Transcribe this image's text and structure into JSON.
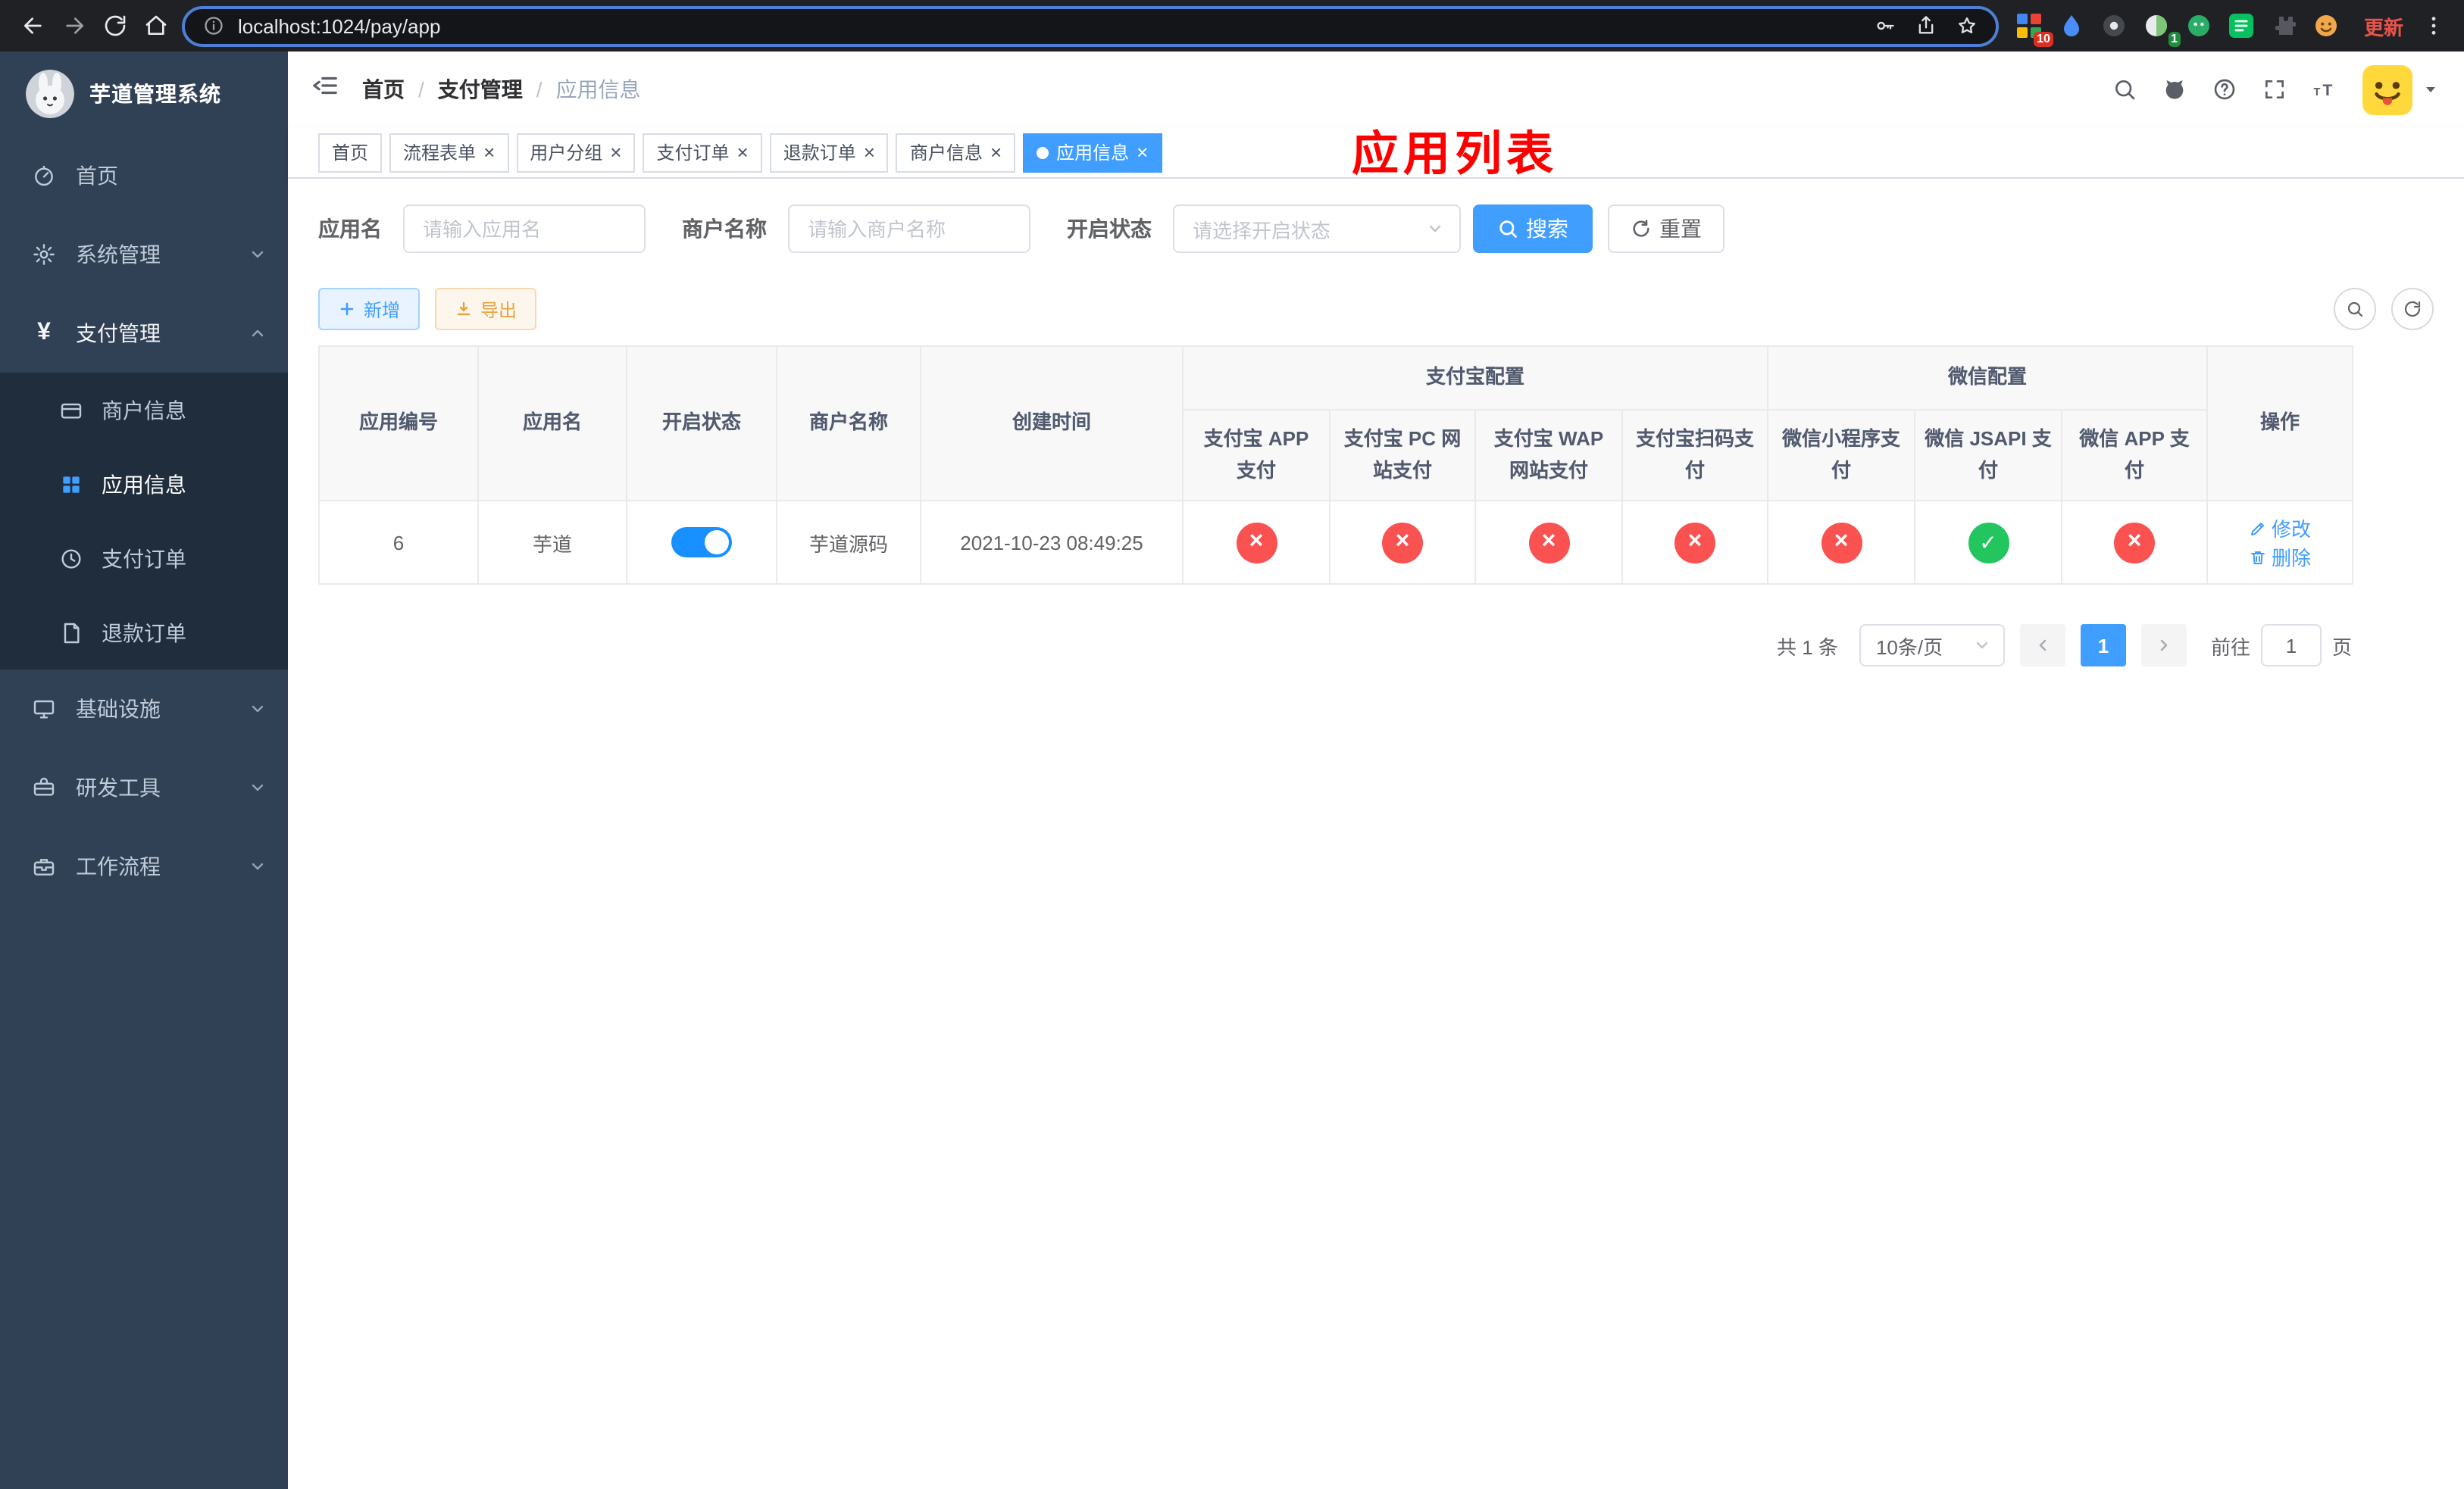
{
  "browser": {
    "url": "localhost:1024/pay/app",
    "update_label": "更新",
    "extension_badge_count": "10",
    "avatar_badge_count": "1"
  },
  "sidebar": {
    "logo_title": "芋道管理系统",
    "items": [
      {
        "label": "首页"
      },
      {
        "label": "系统管理"
      },
      {
        "label": "支付管理"
      },
      {
        "label": "基础设施"
      },
      {
        "label": "研发工具"
      },
      {
        "label": "工作流程"
      }
    ],
    "payment_children": [
      {
        "label": "商户信息"
      },
      {
        "label": "应用信息"
      },
      {
        "label": "支付订单"
      },
      {
        "label": "退款订单"
      }
    ]
  },
  "navbar": {
    "breadcrumb": {
      "home": "首页",
      "section": "支付管理",
      "current": "应用信息"
    },
    "overlay_title": "应用列表"
  },
  "tags": [
    {
      "label": "首页"
    },
    {
      "label": "流程表单"
    },
    {
      "label": "用户分组"
    },
    {
      "label": "支付订单"
    },
    {
      "label": "退款订单"
    },
    {
      "label": "商户信息"
    },
    {
      "label": "应用信息"
    }
  ],
  "filters": {
    "app_name": {
      "label": "应用名",
      "placeholder": "请输入应用名",
      "value": ""
    },
    "merchant_name": {
      "label": "商户名称",
      "placeholder": "请输入商户名称",
      "value": ""
    },
    "status": {
      "label": "开启状态",
      "placeholder": "请选择开启状态",
      "value": ""
    },
    "search_button": "搜索",
    "reset_button": "重置"
  },
  "actions": {
    "add_button": "新增",
    "export_button": "导出"
  },
  "table": {
    "groups": {
      "alipay": "支付宝配置",
      "wechat": "微信配置"
    },
    "columns": {
      "id": "应用编号",
      "name": "应用名",
      "status": "开启状态",
      "merchant": "商户名称",
      "created": "创建时间",
      "alipay_app": "支付宝 APP 支付",
      "alipay_pc": "支付宝 PC 网站支付",
      "alipay_wap": "支付宝 WAP 网站支付",
      "alipay_qr": "支付宝扫码支付",
      "wx_mini": "微信小程序支付",
      "wx_jsapi": "微信 JSAPI 支付",
      "wx_app": "微信 APP 支付",
      "ops": "操作"
    },
    "row": {
      "id": "6",
      "name": "芋道",
      "enabled": true,
      "merchant": "芋道源码",
      "created": "2021-10-23 08:49:25",
      "channels": [
        {
          "name": "支付宝 APP 支付",
          "enabled": false
        },
        {
          "name": "支付宝 PC 网站支付",
          "enabled": false
        },
        {
          "name": "支付宝 WAP 网站支付",
          "enabled": false
        },
        {
          "name": "支付宝扫码支付",
          "enabled": false
        },
        {
          "name": "微信小程序支付",
          "enabled": false
        },
        {
          "name": "微信 JSAPI 支付",
          "enabled": true
        },
        {
          "name": "微信 APP 支付",
          "enabled": false
        }
      ],
      "edit": "修改",
      "delete": "删除"
    }
  },
  "pagination": {
    "total": "共 1 条",
    "page_size": "10条/页",
    "page": "1",
    "goto_label": "前往",
    "goto_value": "1",
    "goto_unit": "页"
  },
  "colors": {
    "primary": "#409eff",
    "toggle_on": "#1890ff",
    "status_on": "#22c55e",
    "status_off": "#fa5151",
    "overlay_title": "#fe0000",
    "sidebar_bg": "#304156",
    "submenu_bg": "#1f2d3d"
  }
}
